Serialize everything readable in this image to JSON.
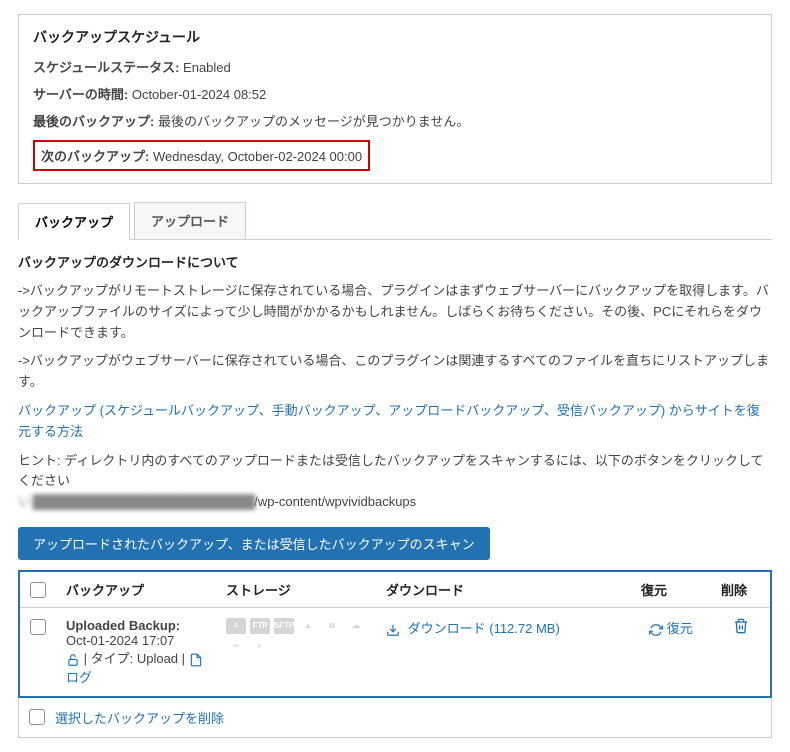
{
  "panel": {
    "title": "バックアップスケジュール",
    "schedule_status_label": "スケジュールステータス:",
    "schedule_status_value": "Enabled",
    "server_time_label": "サーバーの時間:",
    "server_time_value": "October-01-2024 08:52",
    "last_backup_label": "最後のバックアップ:",
    "last_backup_value": "最後のバックアップのメッセージが見つかりません。",
    "next_backup_label": "次のバックアップ:",
    "next_backup_value": "Wednesday, October-02-2024 00:00"
  },
  "tabs": {
    "backup": "バックアップ",
    "upload": "アップロード"
  },
  "section_title": "バックアップのダウンロードについて",
  "info1": "->バックアップがリモートストレージに保存されている場合、プラグインはまずウェブサーバーにバックアップを取得します。バックアップファイルのサイズによって少し時間がかかるかもしれません。しばらくお待ちください。その後、PCにそれらをダウンロードできます。",
  "info2": "->バックアップがウェブサーバーに保存されている場合、このプラグインは関連するすべてのファイルを直ちにリストアップします。",
  "link_text": "バックアップ (スケジュールバックアップ、手動バックアップ、アップロードバックアップ、受信バックアップ) からサイトを復元する方法",
  "hint_prefix": "ヒント: ディレクトリ内のすべてのアップロードまたは受信したバックアップをスキャンするには、以下のボタンをクリックしてください",
  "hint_path": "/wp-content/wpvividbackups",
  "scan_button": "アップロードされたバックアップ、または受信したバックアップのスキャン",
  "table": {
    "headers": {
      "backup": "バックアップ",
      "storage": "ストレージ",
      "download": "ダウンロード",
      "restore": "復元",
      "delete": "削除"
    },
    "row": {
      "backup_title": "Uploaded Backup:",
      "backup_time": "Oct-01-2024 17:07",
      "type_label": "| タイプ: Upload |",
      "log_label": "ログ",
      "download_label": "ダウンロード (112.72 MB)",
      "restore_label": "復元",
      "storage_icons": [
        "目",
        "FTP",
        "SFTP",
        "△",
        "⬡",
        "☁",
        "∞",
        "◯"
      ]
    },
    "footer": "選択したバックアップを削除"
  }
}
